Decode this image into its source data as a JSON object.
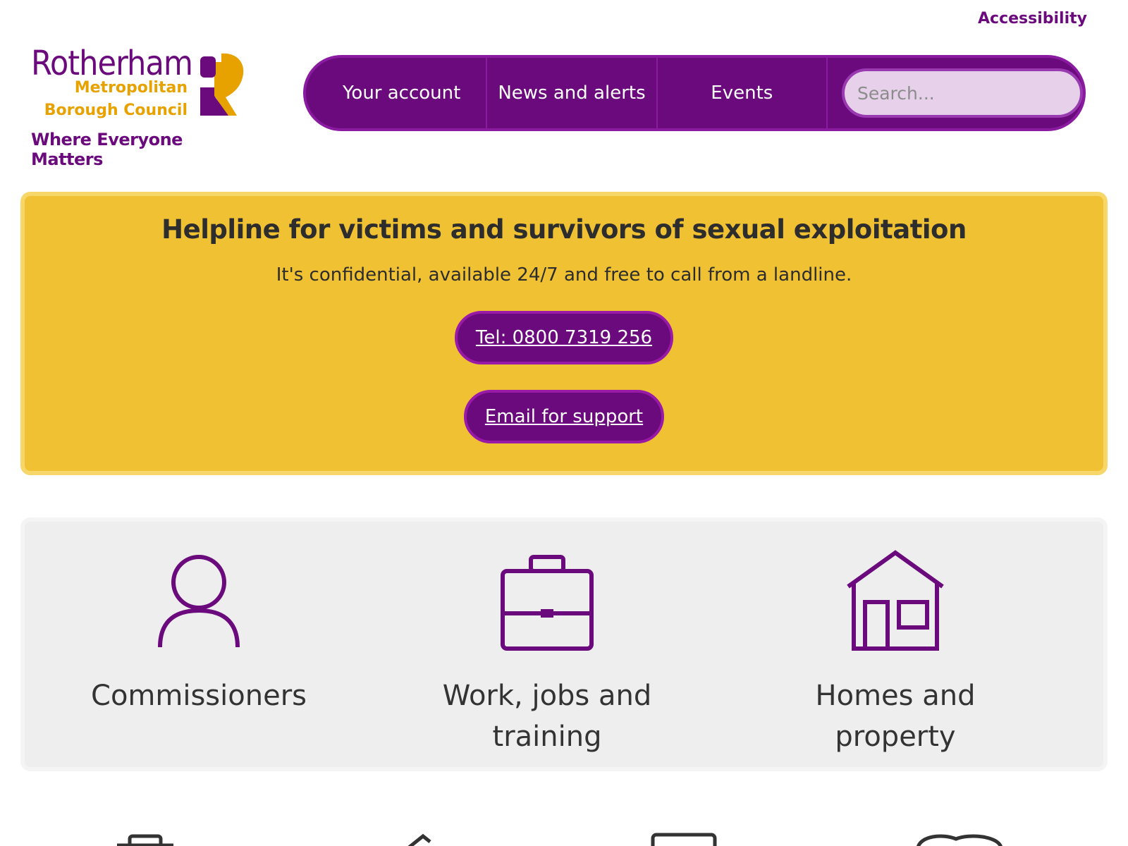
{
  "header": {
    "accessibility_label": "Accessibility",
    "logo": {
      "line1": "Rotherham",
      "line2": "Metropolitan",
      "line3": "Borough Council",
      "tagline": "Where Everyone Matters"
    }
  },
  "nav": {
    "items": [
      {
        "label": "Your account"
      },
      {
        "label": "News and alerts"
      },
      {
        "label": "Events"
      }
    ],
    "search_placeholder": "Search..."
  },
  "alert": {
    "title": "Helpline for victims and survivors of sexual exploitation",
    "body": "It's confidential, available 24/7 and free to call from a landline.",
    "tel_label": "Tel: 0800 7319 256",
    "email_label": "Email for support"
  },
  "tiles": [
    {
      "label": "Commissioners",
      "icon": "person-icon"
    },
    {
      "label": "Work, jobs and training",
      "icon": "briefcase-icon"
    },
    {
      "label": "Homes and property",
      "icon": "house-icon"
    }
  ],
  "colors": {
    "brand_purple": "#6b0a7c",
    "brand_gold": "#e8a200",
    "alert_yellow": "#f0c132",
    "tile_bg": "#eeeeee"
  }
}
